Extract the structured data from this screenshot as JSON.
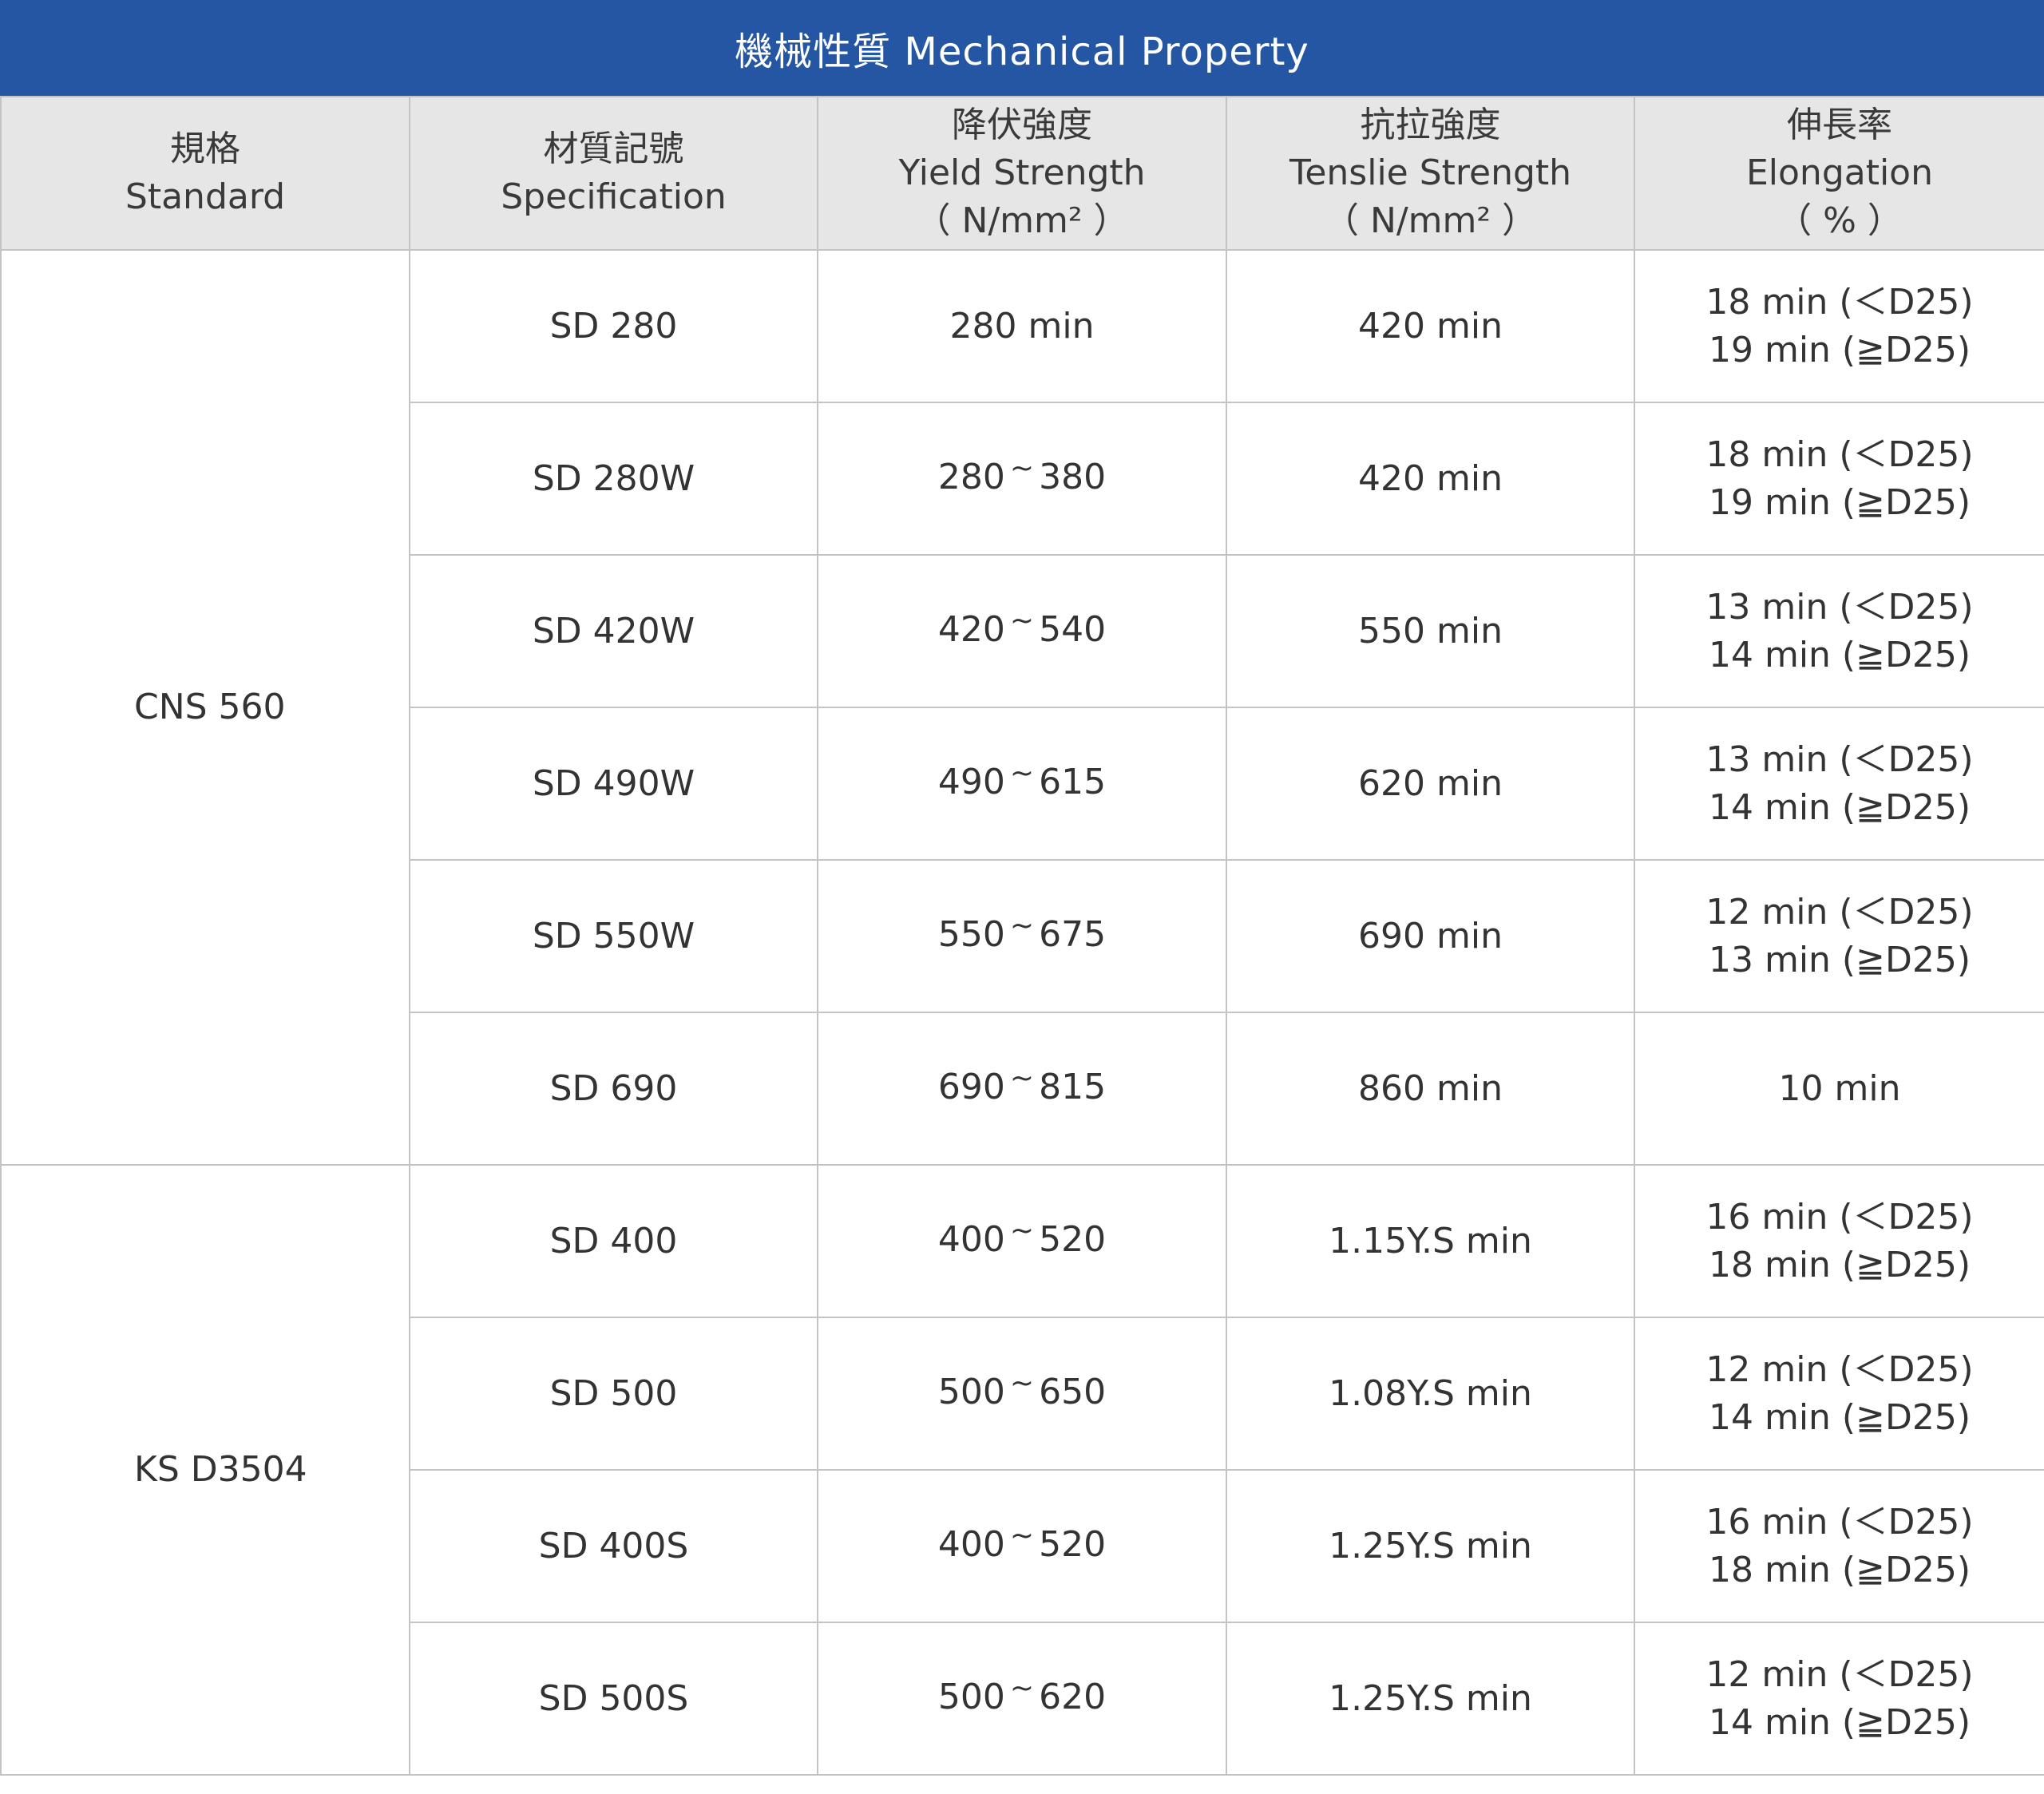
{
  "title": "機械性質 Mechanical Property",
  "headers": [
    {
      "lines": [
        "規格",
        "Standard"
      ]
    },
    {
      "lines": [
        "材質記號",
        "Specification"
      ]
    },
    {
      "lines": [
        "降伏強度",
        "Yield Strength",
        "（ N/mm² ）"
      ]
    },
    {
      "lines": [
        "抗拉強度",
        "Tenslie Strength",
        "（ N/mm² ）"
      ]
    },
    {
      "lines": [
        "伸長率",
        "Elongation",
        "（ % ）"
      ]
    }
  ],
  "groups": [
    {
      "standard": "CNS 560",
      "rows": [
        {
          "spec": "SD 280",
          "yield_from": "280 min",
          "yield_to": "",
          "tensile": "420 min",
          "elongation": [
            "18 min (＜D25)",
            "19 min (≧D25)"
          ]
        },
        {
          "spec": "SD 280W",
          "yield_from": "280",
          "yield_to": "380",
          "tensile": "420 min",
          "elongation": [
            "18 min (＜D25)",
            "19 min (≧D25)"
          ]
        },
        {
          "spec": "SD 420W",
          "yield_from": "420",
          "yield_to": "540",
          "tensile": "550 min",
          "elongation": [
            "13 min (＜D25)",
            "14 min (≧D25)"
          ]
        },
        {
          "spec": "SD 490W",
          "yield_from": "490",
          "yield_to": "615",
          "tensile": "620 min",
          "elongation": [
            "13 min (＜D25)",
            "14 min (≧D25)"
          ]
        },
        {
          "spec": "SD 550W",
          "yield_from": "550",
          "yield_to": "675",
          "tensile": "690 min",
          "elongation": [
            "12 min (＜D25)",
            "13 min (≧D25)"
          ]
        },
        {
          "spec": "SD 690",
          "yield_from": "690",
          "yield_to": "815",
          "tensile": "860 min",
          "elongation": [
            "10 min"
          ]
        }
      ]
    },
    {
      "standard": "KS D3504",
      "rows": [
        {
          "spec": "SD 400",
          "yield_from": "400",
          "yield_to": "520",
          "tensile": "1.15Y.S min",
          "elongation": [
            "16 min (＜D25)",
            "18 min (≧D25)"
          ]
        },
        {
          "spec": "SD 500",
          "yield_from": "500",
          "yield_to": "650",
          "tensile": "1.08Y.S min",
          "elongation": [
            "12 min (＜D25)",
            "14 min (≧D25)"
          ]
        },
        {
          "spec": "SD 400S",
          "yield_from": "400",
          "yield_to": "520",
          "tensile": "1.25Y.S min",
          "elongation": [
            "16 min (＜D25)",
            "18 min (≧D25)"
          ]
        },
        {
          "spec": "SD 500S",
          "yield_from": "500",
          "yield_to": "620",
          "tensile": "1.25Y.S min",
          "elongation": [
            "12 min (＜D25)",
            "14 min (≧D25)"
          ]
        }
      ]
    }
  ],
  "range_separator": "~",
  "colors": {
    "title_bar": "#2456a4",
    "header_bg": "#e6e6e6",
    "border": "#c4c4c4",
    "text": "#333333"
  }
}
